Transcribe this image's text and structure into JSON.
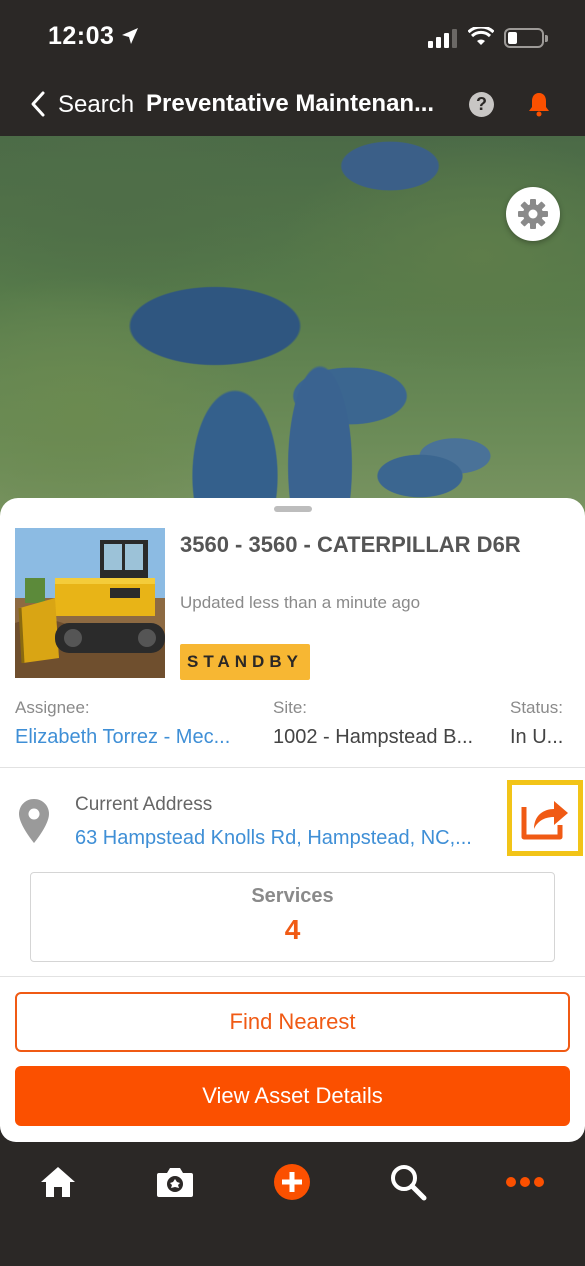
{
  "status_bar": {
    "time": "12:03"
  },
  "nav": {
    "back_label": "Search",
    "title": "Preventative Maintenan...",
    "help_symbol": "?"
  },
  "map": {
    "settings_icon": "gear-icon"
  },
  "asset": {
    "title": "3560 - 3560 - CATERPILLAR D6R",
    "updated": "Updated less than a minute ago",
    "status_badge": "STANDBY",
    "assignee_label": "Assignee:",
    "assignee_value": "Elizabeth Torrez - Mec...",
    "site_label": "Site:",
    "site_value": "1002 - Hampstead B...",
    "status_label": "Status:",
    "status_value": "In U..."
  },
  "address": {
    "label": "Current Address",
    "value": "63 Hampstead Knolls Rd, Hampstead, NC,..."
  },
  "services": {
    "label": "Services",
    "count": "4"
  },
  "actions": {
    "find_nearest": "Find Nearest",
    "view_details": "View Asset Details"
  },
  "tab_bar": {
    "items": [
      "home-icon",
      "camera-icon",
      "add-icon",
      "search-icon",
      "more-icon"
    ]
  },
  "colors": {
    "accent": "#fb5000",
    "link": "#3f8fd6",
    "badge": "#f7b733",
    "highlight": "#f2c418",
    "chrome": "#2b2826"
  }
}
